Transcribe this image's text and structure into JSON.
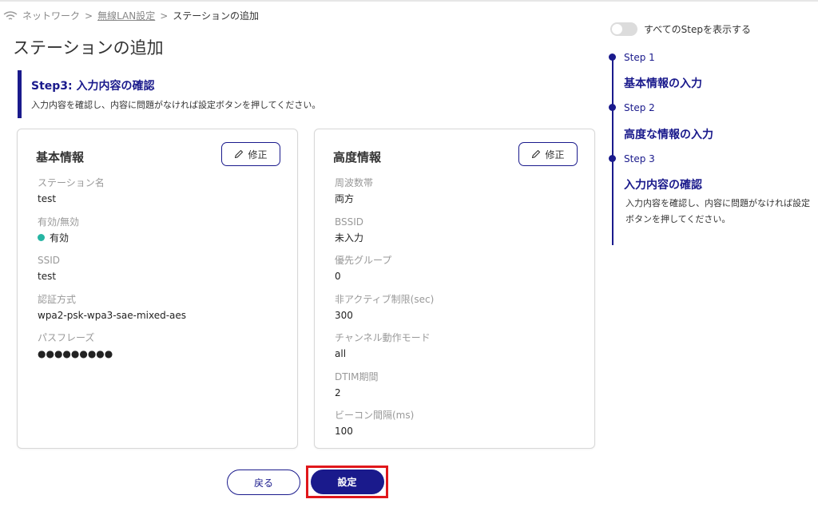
{
  "breadcrumb": {
    "network": "ネットワーク",
    "wlan": "無線LAN設定",
    "current": "ステーションの追加",
    "separator": ">"
  },
  "page_title": "ステーションの追加",
  "step_header": {
    "heading": "Step3: 入力内容の確認",
    "description": "入力内容を確認し、内容に問題がなければ設定ボタンを押してください。"
  },
  "basic_card": {
    "title": "基本情報",
    "edit_label": "修正",
    "fields": [
      {
        "label": "ステーション名",
        "value": "test"
      },
      {
        "label": "有効/無効",
        "value": "有効",
        "status_color": "#26b5a3"
      },
      {
        "label": "SSID",
        "value": "test"
      },
      {
        "label": "認証方式",
        "value": "wpa2-psk-wpa3-sae-mixed-aes"
      },
      {
        "label": "パスフレーズ",
        "value": "●●●●●●●●●"
      }
    ]
  },
  "advanced_card": {
    "title": "高度情報",
    "edit_label": "修正",
    "fields": [
      {
        "label": "周波数帯",
        "value": "両方"
      },
      {
        "label": "BSSID",
        "value": "未入力"
      },
      {
        "label": "優先グループ",
        "value": "0"
      },
      {
        "label": "非アクティブ制限(sec)",
        "value": "300"
      },
      {
        "label": "チャンネル動作モード",
        "value": "all"
      },
      {
        "label": "DTIM期間",
        "value": "2"
      },
      {
        "label": "ビーコン間隔(ms)",
        "value": "100"
      }
    ]
  },
  "buttons": {
    "back": "戻る",
    "submit": "設定"
  },
  "side_panel": {
    "toggle_label": "すべてのStepを表示する",
    "steps": [
      {
        "step": "Step 1",
        "title": "基本情報の入力"
      },
      {
        "step": "Step 2",
        "title": "高度な情報の入力"
      },
      {
        "step": "Step 3",
        "title": "入力内容の確認",
        "description": "入力内容を確認し、内容に問題がなければ設定ボタンを押してください。"
      }
    ]
  },
  "colors": {
    "accent": "#1a1a8c",
    "highlight": "#e0171b",
    "status_on": "#26b5a3"
  },
  "icons": {
    "breadcrumb": "wifi-icon",
    "edit": "pencil-icon"
  }
}
